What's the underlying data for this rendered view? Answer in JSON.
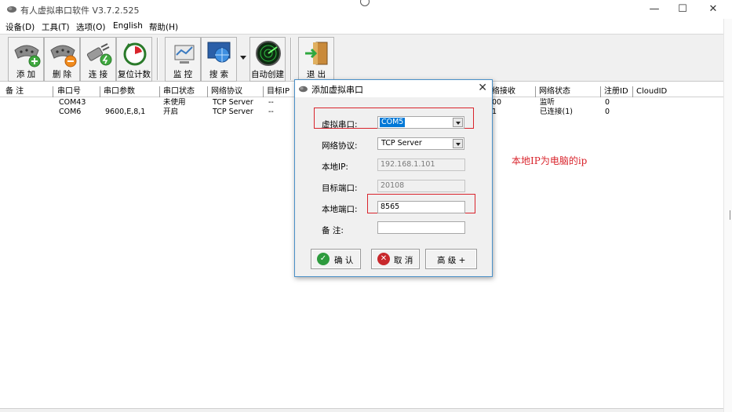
{
  "window": {
    "title": "有人虚拟串口软件 V3.7.2.525",
    "minimize": "—",
    "maximize": "☐",
    "close": "✕"
  },
  "menu": {
    "items": [
      "设备(D)",
      "工具(T)",
      "选项(O)",
      "English",
      "帮助(H)"
    ]
  },
  "toolbar": {
    "add": "添 加",
    "delete": "删 除",
    "connect": "连 接",
    "reset_count": "复位计数",
    "monitor": "监 控",
    "search": "搜 索",
    "auto_create": "自动创建",
    "exit": "退 出"
  },
  "table": {
    "headers": [
      "备 注",
      "串口号",
      "串口参数",
      "串口状态",
      "网络协议",
      "目标IP",
      "网络接收",
      "网络状态",
      "注册ID",
      "CloudID"
    ],
    "rows": [
      [
        "",
        "COM43",
        "",
        "未使用",
        "TCP Server",
        "--",
        "00",
        "监听",
        "0",
        ""
      ],
      [
        "",
        "COM6",
        "9600,E,8,1",
        "开启",
        "TCP Server",
        "--",
        "1",
        "已连接(1)",
        "0",
        ""
      ]
    ]
  },
  "dialog": {
    "title": "添加虚拟串口",
    "close": "✕",
    "virtual_port_label": "虚拟串口:",
    "virtual_port_value": "COM5",
    "protocol_label": "网络协议:",
    "protocol_value": "TCP Server",
    "local_ip_label": "本地IP:",
    "local_ip_value": "192.168.1.101",
    "target_port_label": "目标端口:",
    "target_port_value": "20108",
    "local_port_label": "本地端口:",
    "local_port_value": "8565",
    "note_label": "备 注:",
    "note_value": "",
    "confirm": "确 认",
    "cancel": "取 消",
    "advanced": "高 级 +"
  },
  "annotation": "本地IP为电脑的ip",
  "colors": {
    "annotation_red": "#d9242c",
    "selection_blue": "#0078d7",
    "dialog_border": "#4a90c8",
    "confirm_green": "#2e9b3e",
    "cancel_red": "#c8282c"
  }
}
